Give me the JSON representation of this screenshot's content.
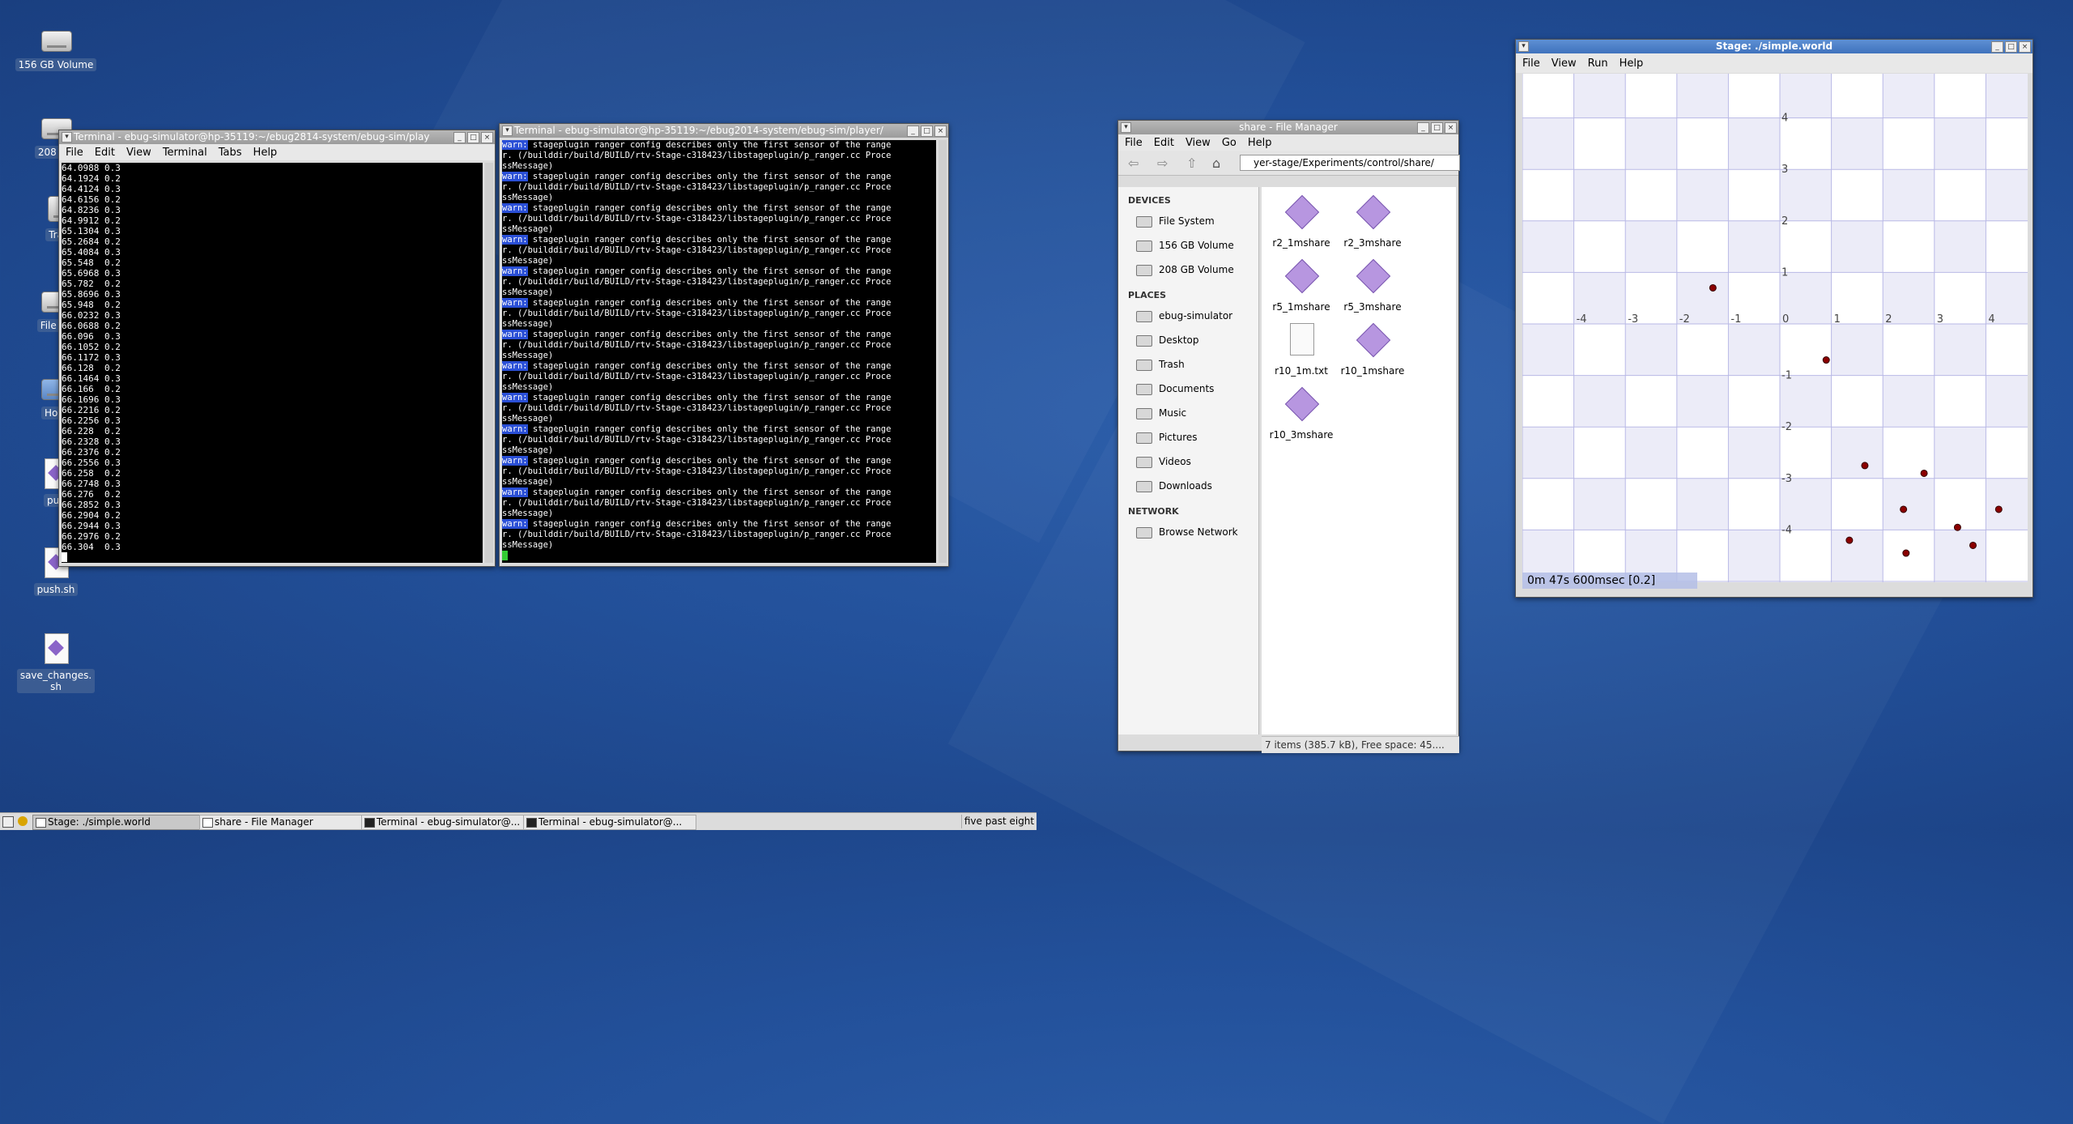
{
  "desktop": {
    "icons": [
      {
        "label": "156 GB Volume",
        "type": "drive"
      },
      {
        "label": "208 GB",
        "type": "drive"
      },
      {
        "label": "Tra",
        "type": "trash"
      },
      {
        "label": "File Sy",
        "type": "drive"
      },
      {
        "label": "Hom",
        "type": "home"
      },
      {
        "label": "pull",
        "type": "script"
      },
      {
        "label": "push.sh",
        "type": "script"
      },
      {
        "label": "save_changes.\nsh",
        "type": "script"
      }
    ]
  },
  "terminal1": {
    "title": "Terminal - ebug-simulator@hp-35119:~/ebug2814-system/ebug-sim/play",
    "menu": [
      "File",
      "Edit",
      "View",
      "Terminal",
      "Tabs",
      "Help"
    ],
    "lines": [
      "64.0988 0.3",
      "64.1924 0.2",
      "64.4124 0.3",
      "64.6156 0.2",
      "64.8236 0.3",
      "64.9912 0.2",
      "65.1304 0.3",
      "65.2684 0.2",
      "65.4084 0.3",
      "65.548  0.2",
      "65.6968 0.3",
      "65.782  0.2",
      "65.8696 0.3",
      "65.948  0.2",
      "66.0232 0.3",
      "66.0688 0.2",
      "66.096  0.3",
      "66.1052 0.2",
      "66.1172 0.3",
      "66.128  0.2",
      "66.1464 0.3",
      "66.166  0.2",
      "66.1696 0.3",
      "66.2216 0.2",
      "66.2256 0.3",
      "66.228  0.2",
      "66.2328 0.3",
      "66.2376 0.2",
      "66.2556 0.3",
      "66.258  0.2",
      "66.2748 0.3",
      "66.276  0.2",
      "66.2852 0.3",
      "66.2904 0.2",
      "66.2944 0.3",
      "66.2976 0.2",
      "66.304  0.3"
    ]
  },
  "terminal2": {
    "title": "Terminal - ebug-simulator@hp-35119:~/ebug2014-system/ebug-sim/player/",
    "warn_tag": "warn:",
    "warn_text": " stageplugin ranger config describes only the first sensor of the range",
    "line2": "r. (/builddir/build/BUILD/rtv-Stage-c318423/libstageplugin/p_ranger.cc Proce",
    "line3": "ssMessage)",
    "repeat": 13
  },
  "filemanager": {
    "title": "share - File Manager",
    "menu": [
      "File",
      "Edit",
      "View",
      "Go",
      "Help"
    ],
    "path": "yer-stage/Experiments/control/share/",
    "sections": [
      {
        "title": "DEVICES",
        "items": [
          "File System",
          "156 GB Volume",
          "208 GB Volume"
        ]
      },
      {
        "title": "PLACES",
        "items": [
          "ebug-simulator",
          "Desktop",
          "Trash",
          "Documents",
          "Music",
          "Pictures",
          "Videos",
          "Downloads"
        ]
      },
      {
        "title": "NETWORK",
        "items": [
          "Browse Network"
        ]
      }
    ],
    "files": [
      {
        "name": "r2_1mshare",
        "kind": "script"
      },
      {
        "name": "r2_3mshare",
        "kind": "script"
      },
      {
        "name": "r5_1mshare",
        "kind": "script"
      },
      {
        "name": "r5_3mshare",
        "kind": "script"
      },
      {
        "name": "r10_1m.txt",
        "kind": "txt"
      },
      {
        "name": "r10_1mshare",
        "kind": "script"
      },
      {
        "name": "r10_3mshare",
        "kind": "script"
      }
    ],
    "status": "7 items (385.7 kB), Free space: 45...."
  },
  "stage": {
    "title": "Stage: ./simple.world",
    "menu": [
      "File",
      "View",
      "Run",
      "Help"
    ],
    "status_time": "0m 47s 600msec [0.2]",
    "xticks": [
      "-4",
      "-3",
      "-2",
      "-1",
      "0",
      "1",
      "2",
      "3",
      "4"
    ],
    "yticks": [
      "4",
      "3",
      "2",
      "1",
      "-1",
      "-2",
      "-3",
      "-4"
    ],
    "robots": [
      {
        "x": -1.3,
        "y": 0.7
      },
      {
        "x": 0.9,
        "y": -0.7
      },
      {
        "x": 1.65,
        "y": -2.75
      },
      {
        "x": 2.8,
        "y": -2.9
      },
      {
        "x": 2.4,
        "y": -3.6
      },
      {
        "x": 4.25,
        "y": -3.6
      },
      {
        "x": 3.45,
        "y": -3.95
      },
      {
        "x": 1.35,
        "y": -4.2
      },
      {
        "x": 2.45,
        "y": -4.45
      },
      {
        "x": 3.75,
        "y": -4.3
      }
    ],
    "colors": {
      "grid": "#b9b9e6",
      "cell_shade": "#ececf8",
      "robot": "#8b0000"
    }
  },
  "taskbar": {
    "items": [
      "Stage: ./simple.world",
      "share - File Manager",
      "Terminal - ebug-simulator@...",
      "Terminal - ebug-simulator@..."
    ],
    "clock": "five past eight"
  }
}
